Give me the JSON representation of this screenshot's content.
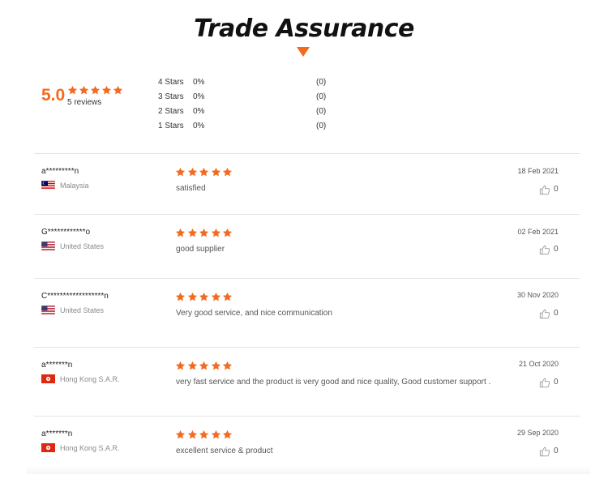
{
  "header": {
    "title": "Trade Assurance"
  },
  "summary": {
    "score": "5.0",
    "rating_out_of_5": 5,
    "reviews_label": "5 reviews",
    "distribution": [
      {
        "label": "4 Stars",
        "percent": "0%",
        "count": "(0)"
      },
      {
        "label": "3 Stars",
        "percent": "0%",
        "count": "(0)"
      },
      {
        "label": "2 Stars",
        "percent": "0%",
        "count": "(0)"
      },
      {
        "label": "1 Stars",
        "percent": "0%",
        "count": "(0)"
      }
    ]
  },
  "colors": {
    "accent": "#f26b21",
    "divider": "#e3e3e3",
    "muted": "#8a8a8a"
  },
  "reviews": [
    {
      "user": "a*********n",
      "country": "Malaysia",
      "flag": "malaysia-flag-icon",
      "rating": 5,
      "comment": "satisfied",
      "date": "18 Feb 2021",
      "likes": "0"
    },
    {
      "user": "G************o",
      "country": "United States",
      "flag": "us-flag-icon",
      "rating": 5,
      "comment": "good supplier",
      "date": "02 Feb 2021",
      "likes": "0"
    },
    {
      "user": "C******************n",
      "country": "United States",
      "flag": "us-flag-icon",
      "rating": 5,
      "comment": "Very good service, and nice communication",
      "date": "30 Nov 2020",
      "likes": "0"
    },
    {
      "user": "a*******n",
      "country": "Hong Kong S.A.R.",
      "flag": "hong-kong-flag-icon",
      "rating": 5,
      "comment": "very fast service and the product is very good and nice quality, Good customer support .",
      "date": "21 Oct 2020",
      "likes": "0"
    },
    {
      "user": "a*******n",
      "country": "Hong Kong S.A.R.",
      "flag": "hong-kong-flag-icon",
      "rating": 5,
      "comment": "excellent service & product",
      "date": "29 Sep 2020",
      "likes": "0"
    }
  ]
}
